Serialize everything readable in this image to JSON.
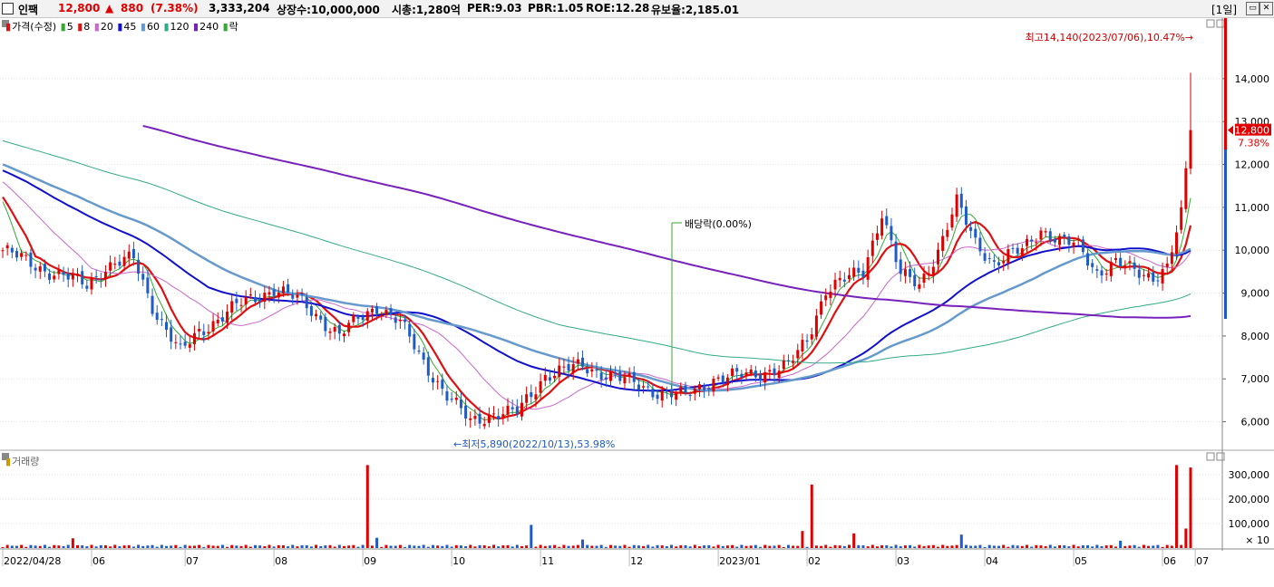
{
  "header": {
    "stock_name": "인팩",
    "price": "12,800",
    "change_arrow": "▲",
    "change": "880",
    "change_pct": "(7.38%)",
    "volume": "3,333,204",
    "shares_listed": "상장수:10,000,000",
    "market_cap": "시총:1,280억",
    "per": "PER:9.03",
    "pbr": "PBR:1.05",
    "roe": "ROE:12.28",
    "reserve_ratio": "유보율:2,185.01",
    "period": "[1일]"
  },
  "legend": {
    "price_label": "가격(수정)",
    "ma": [
      "5",
      "8",
      "20",
      "45",
      "60",
      "120",
      "240"
    ],
    "ma_colors": [
      "#33aa33",
      "#dd1111",
      "#cc66cc",
      "#1111cc",
      "#6699cc",
      "#33aa88",
      "#7722bb"
    ],
    "dividend_label": "락"
  },
  "volume_legend": "거래량",
  "chart_data": {
    "type": "candlestick",
    "price_axis": {
      "ticks": [
        "14,000",
        "13,000",
        "12,000",
        "11,000",
        "10,000",
        "9,000",
        "8,000",
        "7,000",
        "6,000"
      ],
      "ylim": [
        5400,
        15200
      ]
    },
    "volume_axis": {
      "ticks": [
        "300,000",
        "200,000",
        "100,000"
      ],
      "unit_label": "× 10"
    },
    "x_labels": [
      "2022/04/28",
      "06",
      "07",
      "08",
      "09",
      "10",
      "11",
      "12",
      "2023/01",
      "02",
      "03",
      "04",
      "05",
      "06",
      "07"
    ],
    "current_price_label": "12,800",
    "current_pct_label": "7.38%",
    "annotations": {
      "high": "최고14,140(2023/07/06),10.47%→",
      "low": "←최저5,890(2022/10/13),53.98%",
      "dividend": "배당락(0.00%)"
    },
    "ohlc_anchors": [
      [
        0,
        10000
      ],
      [
        10,
        9500
      ],
      [
        18,
        9200
      ],
      [
        22,
        9600
      ],
      [
        28,
        9800
      ],
      [
        32,
        8700
      ],
      [
        38,
        7600
      ],
      [
        42,
        8100
      ],
      [
        50,
        8700
      ],
      [
        58,
        9100
      ],
      [
        64,
        8800
      ],
      [
        68,
        8400
      ],
      [
        72,
        8000
      ],
      [
        76,
        8400
      ],
      [
        80,
        8700
      ],
      [
        85,
        8300
      ],
      [
        90,
        7400
      ],
      [
        95,
        6600
      ],
      [
        100,
        6000
      ],
      [
        105,
        6200
      ],
      [
        110,
        6200
      ],
      [
        116,
        7100
      ],
      [
        124,
        7300
      ],
      [
        132,
        7000
      ],
      [
        140,
        6700
      ],
      [
        146,
        6600
      ],
      [
        152,
        7000
      ],
      [
        160,
        7100
      ],
      [
        168,
        7300
      ],
      [
        172,
        7900
      ],
      [
        176,
        9100
      ],
      [
        180,
        9300
      ],
      [
        184,
        9500
      ],
      [
        188,
        10900
      ],
      [
        192,
        9400
      ],
      [
        196,
        9200
      ],
      [
        200,
        10000
      ],
      [
        204,
        11100
      ],
      [
        208,
        10200
      ],
      [
        212,
        9700
      ],
      [
        218,
        10000
      ],
      [
        222,
        10500
      ],
      [
        226,
        10200
      ],
      [
        230,
        10100
      ],
      [
        234,
        9500
      ],
      [
        238,
        9700
      ],
      [
        242,
        9500
      ],
      [
        246,
        9400
      ],
      [
        249,
        9600
      ],
      [
        252,
        10800
      ],
      [
        254,
        12800
      ]
    ],
    "volume_spikes": [
      {
        "i": 15,
        "v": 40000
      },
      {
        "i": 78,
        "v": 340000
      },
      {
        "i": 80,
        "v": 42000
      },
      {
        "i": 113,
        "v": 95000
      },
      {
        "i": 124,
        "v": 35000
      },
      {
        "i": 171,
        "v": 70000
      },
      {
        "i": 173,
        "v": 260000
      },
      {
        "i": 182,
        "v": 60000
      },
      {
        "i": 205,
        "v": 55000
      },
      {
        "i": 239,
        "v": 30000
      },
      {
        "i": 251,
        "v": 340000
      },
      {
        "i": 253,
        "v": 80000
      },
      {
        "i": 254,
        "v": 330000
      }
    ]
  }
}
